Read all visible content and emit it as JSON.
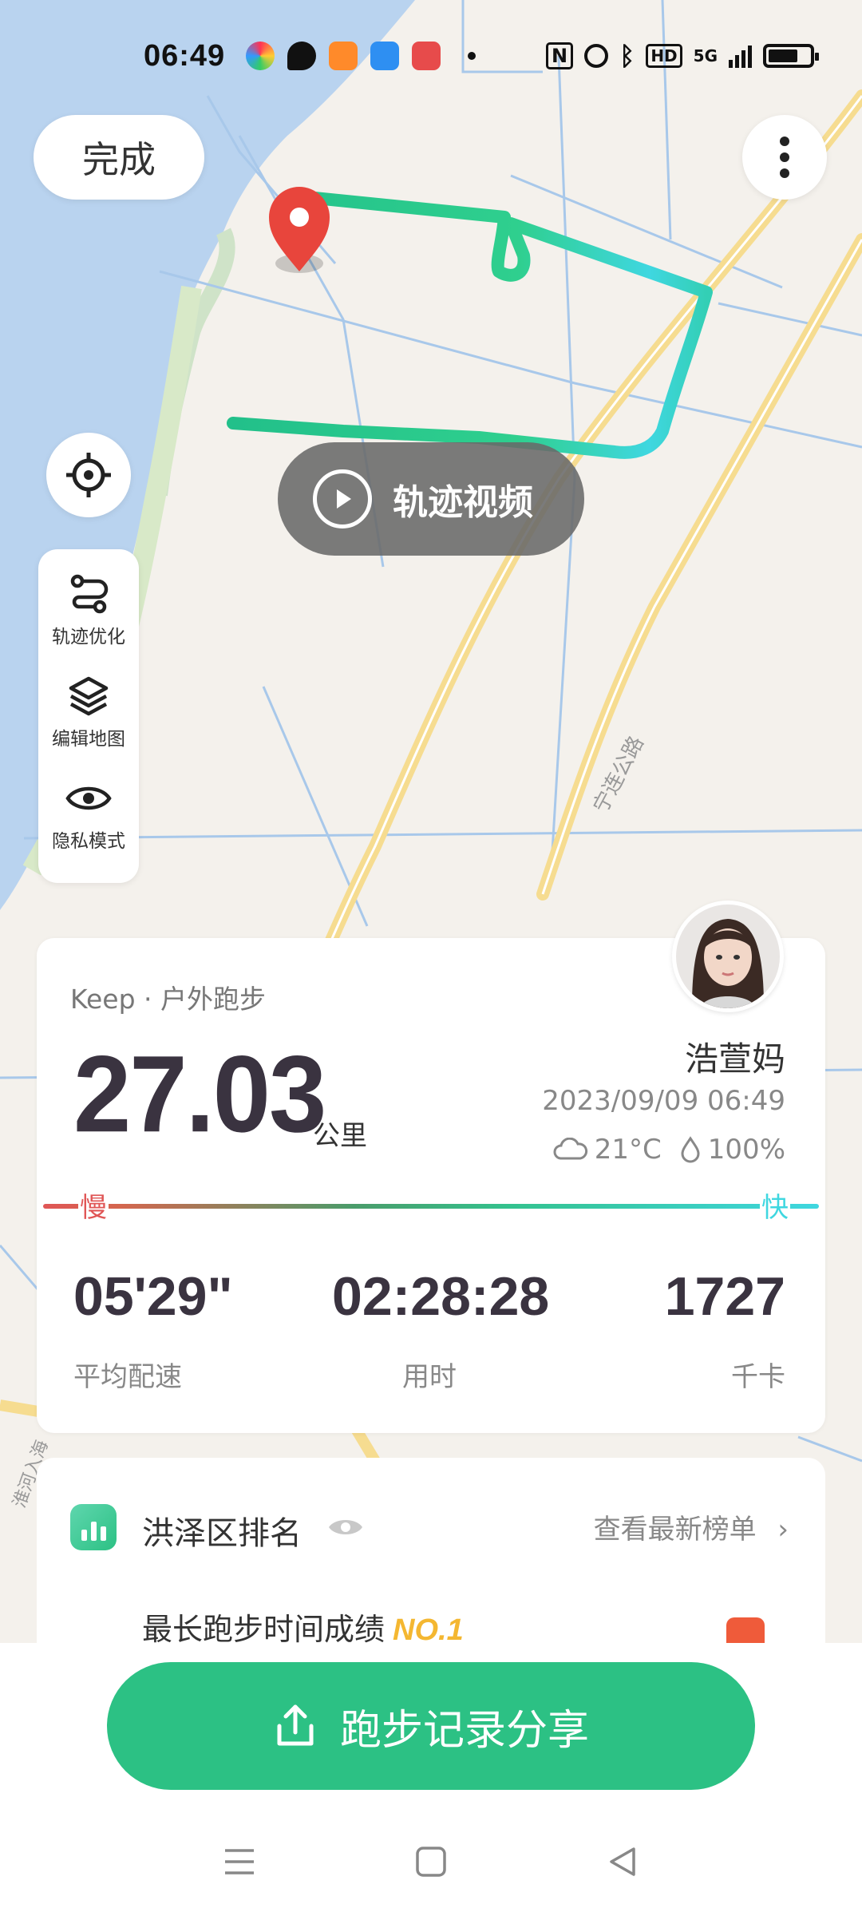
{
  "status_bar": {
    "time": "06:49",
    "app_icons": [
      "colorful-app-icon",
      "wechat-icon",
      "orange-app-icon",
      "blue-app-icon",
      "red-app-icon"
    ],
    "network": "5G",
    "hd_label": "HD"
  },
  "top_controls": {
    "done_label": "完成"
  },
  "map": {
    "road_label": "宁连公路",
    "road_label_2": "淮河入海"
  },
  "track_video": {
    "label": "轨迹视频"
  },
  "tools": [
    {
      "label": "轨迹优化"
    },
    {
      "label": "编辑地图"
    },
    {
      "label": "隐私模式"
    }
  ],
  "stats": {
    "source": "Keep · 户外跑步",
    "distance": "27.03",
    "distance_unit": "公里",
    "username": "浩萱妈",
    "datetime": "2023/09/09 06:49",
    "temperature": "21°C",
    "humidity": "100%",
    "slow_label": "慢",
    "fast_label": "快",
    "pace": "05'29\"",
    "pace_label": "平均配速",
    "duration": "02:28:28",
    "duration_label": "用时",
    "calories": "1727",
    "calories_label": "千卡"
  },
  "ranking": {
    "title": "洪泽区排名",
    "link_label": "查看最新榜单",
    "item_label": "最长跑步时间成绩",
    "item_rank": "NO.1"
  },
  "share": {
    "label": "跑步记录分享"
  },
  "colors": {
    "accent_green": "#2cc184",
    "route_green": "#2fcf8e",
    "route_cyan": "#3fd7e0",
    "pin_red": "#e8453c",
    "rank_gold": "#f4b731"
  }
}
